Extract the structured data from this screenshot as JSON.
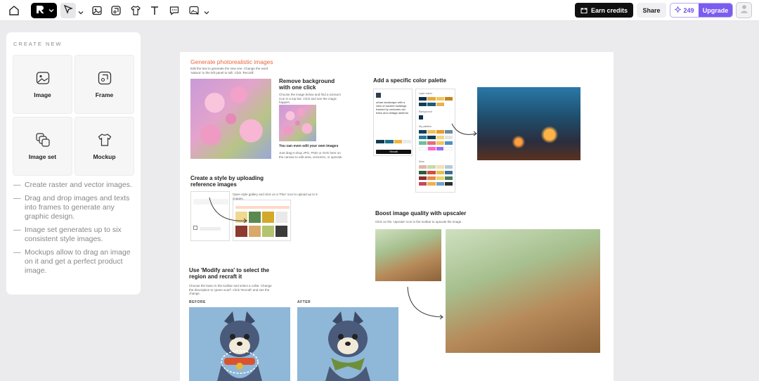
{
  "toolbar": {
    "icons": [
      "home-icon",
      "logo-icon",
      "pointer-icon",
      "image-icon",
      "frame-icon",
      "mockup-icon",
      "text-icon",
      "comment-icon",
      "image-edit-icon"
    ],
    "earn_credits_label": "Earn credits",
    "share_label": "Share",
    "credits": "249",
    "upgrade_label": "Upgrade"
  },
  "create_panel": {
    "heading": "CREATE NEW",
    "tiles": [
      {
        "label": "Image",
        "icon": "image-icon"
      },
      {
        "label": "Frame",
        "icon": "frame-icon"
      },
      {
        "label": "Image set",
        "icon": "image-set-icon"
      },
      {
        "label": "Mockup",
        "icon": "shirt-icon"
      }
    ],
    "tips": [
      "Create raster and vector images.",
      "Drag and drop images and texts into frames to generate any graphic design.",
      "Image set generates up to six consistent style images.",
      "Mockups allow to drag an image on it and get a perfect product image."
    ]
  },
  "board": {
    "gen_title": "Generate photorealistic images",
    "gen_desc": "Edit the text to generate the new one. Change the word 'sakura' to the left panel to tulli. Click 'Recraft'.",
    "remove_bg_title": "Remove background with one click",
    "remove_bg_desc": "Choose the image below and find a scissors icon in a top bar. Click and see the magic happen.",
    "edit_own_title": "You can even edit your own images",
    "edit_own_desc": "Just drag-n-drop JPG, PNG or SVG here on the canvas to edit area, vectorize, or upscale.",
    "palette_title": "Add a specific color palette",
    "palette_prompt": "urban landscape with a view of ancient buildings framed by centuries old trees and vintage lanterns",
    "palette_labels": [
      "Layer colors",
      "Background",
      "My palettes",
      "More"
    ],
    "palette_button": "Recraft",
    "style_title": "Create a style by uploading reference images",
    "style_desc": "Open style gallery and click on a 'Plus' icon to upload up to 5 images.",
    "upscale_title": "Boost image quality with upscaler",
    "upscale_desc": "Click on the 'Upscale' icon in the toolbar to upscale the image.",
    "modify_title": "Use 'Modify area' to select the region  and recraft it",
    "modify_desc": "Choose the lasso in the toolbar and select a collar. Change the description to 'green scarf'. Click 'Recraft' and see the change.",
    "before_label": "BEFORE",
    "after_label": "AFTER"
  },
  "colors": {
    "accent": "#7b5cf0",
    "orange_heading": "#e9663a",
    "canvas_bg": "#ebebed"
  }
}
